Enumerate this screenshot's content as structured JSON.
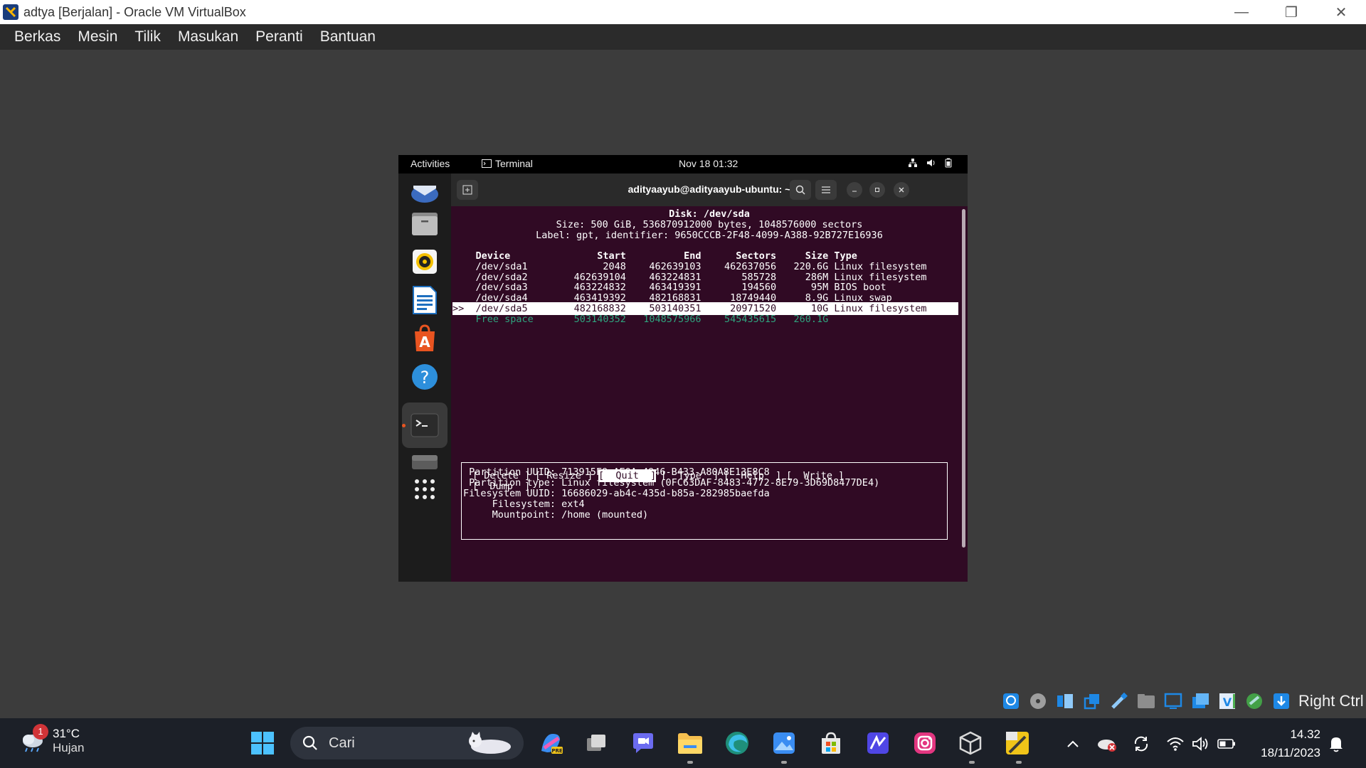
{
  "host_window": {
    "title": "adtya [Berjalan] - Oracle VM VirtualBox",
    "controls": {
      "minimize": "—",
      "restore": "❐",
      "close": "✕"
    }
  },
  "host_menu": [
    "Berkas",
    "Mesin",
    "Tilik",
    "Masukan",
    "Peranti",
    "Bantuan"
  ],
  "guest": {
    "topbar": {
      "activities": "Activities",
      "app": "Terminal",
      "clock": "Nov 18  01:32"
    },
    "dock_items": [
      "thunderbird-icon",
      "files-icon",
      "rhythmbox-icon",
      "writer-icon",
      "app-center-icon",
      "help-icon",
      "terminal-icon",
      "drive-icon",
      "app-grid-icon"
    ],
    "terminal": {
      "title": "adityaayub@adityaayub-ubuntu: ~",
      "disk_title": "Disk: /dev/sda",
      "size_line": "Size: 500 GiB, 536870912000 bytes, 1048576000 sectors",
      "label_line": "Label: gpt, identifier: 9650CCCB-2F48-4099-A388-92B727E16936",
      "table_header": "    Device               Start          End      Sectors     Size Type",
      "rows": [
        "    /dev/sda1             2048    462639103    462637056   220.6G Linux filesystem",
        "    /dev/sda2        462639104    463224831       585728     286M Linux filesystem",
        "    /dev/sda3        463224832    463419391       194560      95M BIOS boot",
        "    /dev/sda4        463419392    482168831     18749440     8.9G Linux swap"
      ],
      "selected_row": ">>  /dev/sda5        482168832    503140351     20971520      10G Linux filesystem",
      "free_row": "    Free space       503140352   1048575966    545435615   260.1G",
      "info": [
        " Partition UUID: 713915F9-AE0A-4946-B433-A80A8E13E8C8",
        " Partition type: Linux filesystem (0FC63DAF-8483-4772-8E79-3D69D8477DE4)",
        "Filesystem UUID: 16686029-ab4c-435d-b85a-282985baefda",
        "     Filesystem: ext4",
        "     Mountpoint: /home (mounted)"
      ],
      "buttons": {
        "delete": "[ Delete ]",
        "resize": "[ Resize ]",
        "quit": "[  Quit  ]",
        "type": "[  Type  ]",
        "help": "[  Help  ]",
        "write": "[  Write ]",
        "dump": "[  Dump  ]"
      }
    }
  },
  "host_status": {
    "right_ctrl": "Right Ctrl"
  },
  "taskbar": {
    "weather_temp": "31°C",
    "weather_cond": "Hujan",
    "weather_badge": "1",
    "search_placeholder": "Cari",
    "time": "14.32",
    "date": "18/11/2023"
  },
  "colors": {
    "terminal_bg": "#300a24",
    "free_space": "#2fa37e",
    "ubuntu_orange": "#e95420",
    "taskbar_bg": "#1c2028"
  }
}
